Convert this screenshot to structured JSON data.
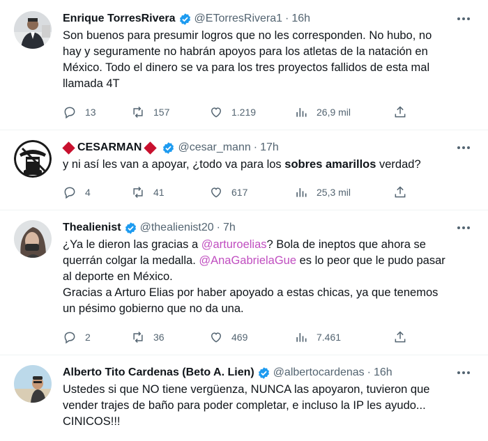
{
  "colors": {
    "accent": "#1d9bf0",
    "mention": "#c04ec0",
    "muted": "#536471",
    "text": "#0f1419"
  },
  "tweets": [
    {
      "name": "Enrique TorresRivera",
      "handle": "@ETorresRivera1",
      "time": "16h",
      "lines": [
        "Son buenos para presumir logros que no les corresponden. No hubo, no",
        "hay y seguramente no habrán apoyos para los atletas de la natación en",
        "México. Todo el dinero se va para los tres proyectos fallidos de esta mal",
        "llamada 4T"
      ],
      "replies": "13",
      "reposts": "157",
      "likes": "1.219",
      "views": "26,9 mil"
    },
    {
      "name": "CESARMAN",
      "handle": "@cesar_mann",
      "time": "17h",
      "text_before": "y ni así les van a apoyar, ¿todo va para los ",
      "text_bold": "sobres amarillos",
      "text_after": " verdad?",
      "replies": "4",
      "reposts": "41",
      "likes": "617",
      "views": "25,3 mil"
    },
    {
      "name": "Thealienist",
      "handle": "@thealienist20",
      "time": "7h",
      "line1_before": "¿Ya le dieron las gracias a ",
      "mention1": "@arturoelias",
      "line1_after": "? Bola de ineptos que ahora se",
      "line2": "querrán colgar la medalla. ",
      "mention2": "@AnaGabrielaGue",
      "line2_after": " es lo peor que le pudo pasar",
      "line3": "al deporte en México.",
      "line4": "Gracias a Arturo Elias por haber apoyado a estas chicas, ya que tenemos",
      "line5": "un pésimo gobierno que no da una.",
      "replies": "2",
      "reposts": "36",
      "likes": "469",
      "views": "7.461"
    },
    {
      "name": "Alberto Tito Cardenas (Beto A. Lien)",
      "handle": "@albertocardenas",
      "time": "16h",
      "lines": [
        "Ustedes si que NO tiene vergüenza, NUNCA las apoyaron, tuvieron que",
        "vender trajes de baño para poder completar, e incluso la IP les ayudo...",
        "CINICOS!!!"
      ]
    }
  ],
  "sep": "·"
}
